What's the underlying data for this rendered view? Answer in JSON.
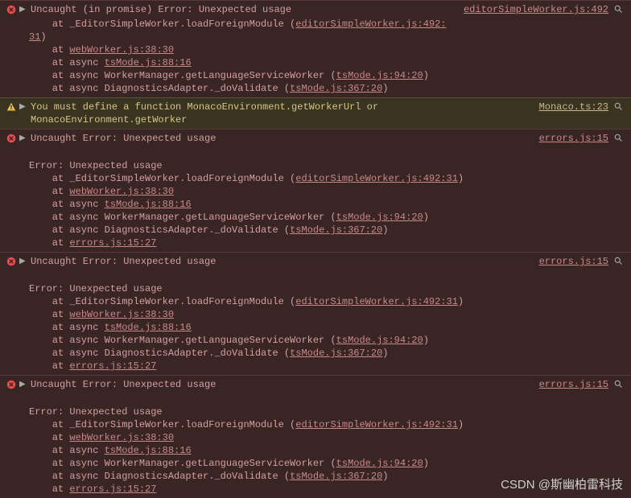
{
  "entries": [
    {
      "type": "error",
      "message": "Uncaught (in promise) Error: Unexpected usage",
      "source": "editorSimpleWorker.js:492",
      "stack": [
        {
          "prefix": "    at _EditorSimpleWorker.loadForeignModule (",
          "link": "editorSimpleWorker.js:492:31",
          "wrap": true,
          "suffix": ")"
        },
        {
          "prefix": "    at ",
          "link": "webWorker.js:38:30",
          "suffix": ""
        },
        {
          "prefix": "    at async ",
          "link": "tsMode.js:88:16",
          "suffix": ""
        },
        {
          "prefix": "    at async WorkerManager.getLanguageServiceWorker (",
          "link": "tsMode.js:94:20",
          "suffix": ")"
        },
        {
          "prefix": "    at async DiagnosticsAdapter._doValidate (",
          "link": "tsMode.js:367:20",
          "suffix": ")"
        }
      ]
    },
    {
      "type": "warning",
      "message": "You must define a function MonacoEnvironment.getWorkerUrl or MonacoEnvironment.getWorker",
      "source": "Monaco.ts:23",
      "stack": []
    },
    {
      "type": "error",
      "message": "Uncaught Error: Unexpected usage",
      "source": "errors.js:15",
      "stack": [
        {
          "prefix": "",
          "text": "Error: Unexpected usage"
        },
        {
          "prefix": "    at _EditorSimpleWorker.loadForeignModule (",
          "link": "editorSimpleWorker.js:492:31",
          "suffix": ")"
        },
        {
          "prefix": "    at ",
          "link": "webWorker.js:38:30",
          "suffix": ""
        },
        {
          "prefix": "    at async ",
          "link": "tsMode.js:88:16",
          "suffix": ""
        },
        {
          "prefix": "    at async WorkerManager.getLanguageServiceWorker (",
          "link": "tsMode.js:94:20",
          "suffix": ")"
        },
        {
          "prefix": "    at async DiagnosticsAdapter._doValidate (",
          "link": "tsMode.js:367:20",
          "suffix": ")"
        },
        {
          "prefix": "    at ",
          "link": "errors.js:15:27",
          "suffix": ""
        }
      ],
      "gap": true
    },
    {
      "type": "error",
      "message": "Uncaught Error: Unexpected usage",
      "source": "errors.js:15",
      "stack": [
        {
          "prefix": "",
          "text": "Error: Unexpected usage"
        },
        {
          "prefix": "    at _EditorSimpleWorker.loadForeignModule (",
          "link": "editorSimpleWorker.js:492:31",
          "suffix": ")"
        },
        {
          "prefix": "    at ",
          "link": "webWorker.js:38:30",
          "suffix": ""
        },
        {
          "prefix": "    at async ",
          "link": "tsMode.js:88:16",
          "suffix": ""
        },
        {
          "prefix": "    at async WorkerManager.getLanguageServiceWorker (",
          "link": "tsMode.js:94:20",
          "suffix": ")"
        },
        {
          "prefix": "    at async DiagnosticsAdapter._doValidate (",
          "link": "tsMode.js:367:20",
          "suffix": ")"
        },
        {
          "prefix": "    at ",
          "link": "errors.js:15:27",
          "suffix": ""
        }
      ],
      "gap": true
    },
    {
      "type": "error",
      "message": "Uncaught Error: Unexpected usage",
      "source": "errors.js:15",
      "stack": [
        {
          "prefix": "",
          "text": "Error: Unexpected usage"
        },
        {
          "prefix": "    at _EditorSimpleWorker.loadForeignModule (",
          "link": "editorSimpleWorker.js:492:31",
          "suffix": ")"
        },
        {
          "prefix": "    at ",
          "link": "webWorker.js:38:30",
          "suffix": ""
        },
        {
          "prefix": "    at async ",
          "link": "tsMode.js:88:16",
          "suffix": ""
        },
        {
          "prefix": "    at async WorkerManager.getLanguageServiceWorker (",
          "link": "tsMode.js:94:20",
          "suffix": ")"
        },
        {
          "prefix": "    at async DiagnosticsAdapter._doValidate (",
          "link": "tsMode.js:367:20",
          "suffix": ")"
        },
        {
          "prefix": "    at ",
          "link": "errors.js:15:27",
          "suffix": ""
        }
      ],
      "gap": true
    }
  ],
  "watermark": "CSDN @斯幽柏雷科技"
}
